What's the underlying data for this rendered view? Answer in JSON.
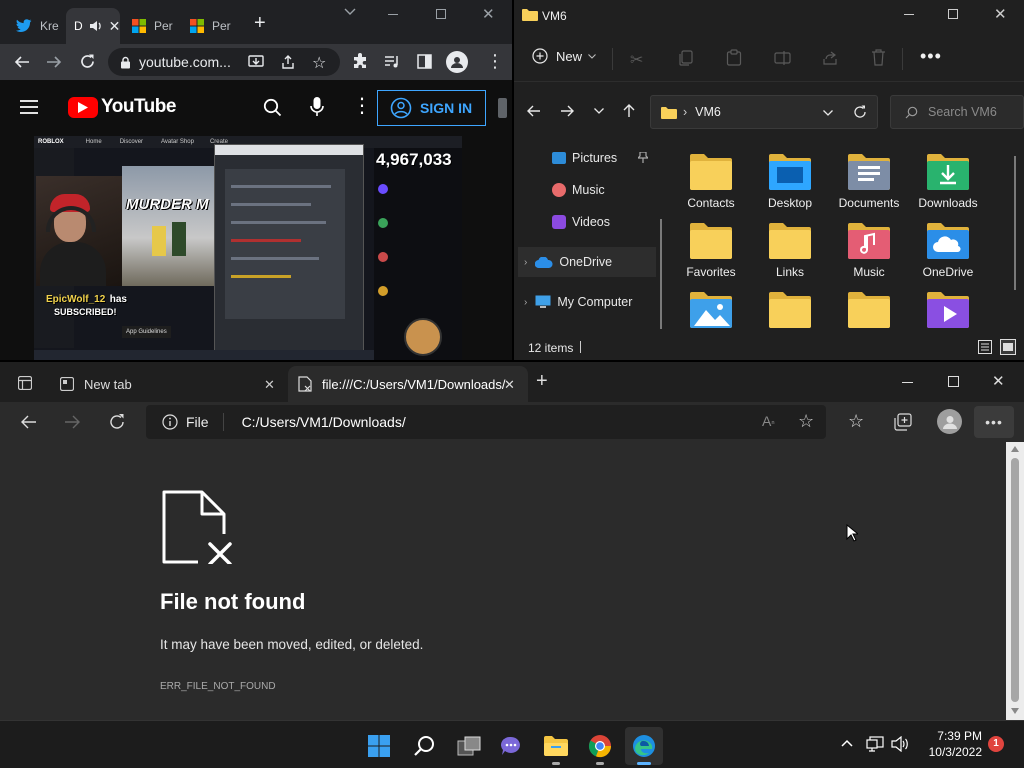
{
  "chrome": {
    "tabs": [
      {
        "label": "Kre"
      },
      {
        "label": "D"
      },
      {
        "label": "Per"
      },
      {
        "label": "Per"
      }
    ],
    "url": "youtube.com...",
    "youtube": {
      "brand": "YouTube",
      "sign_in": "SIGN IN",
      "video": {
        "viewer_count": "4,967,033",
        "game_title": "MURDER M",
        "sub_user": "EpicWolf_12",
        "sub_text_has": "has",
        "sub_text_subscribed": "SUBSCRIBED!",
        "roblox_brand": "ROBLOX",
        "menu": [
          "Home",
          "Discover",
          "Avatar Shop",
          "Create"
        ],
        "app_guidelines": "App Guidelines"
      }
    }
  },
  "explorer": {
    "title": "VM6",
    "new_label": "New",
    "path": "VM6",
    "search_placeholder": "Search VM6",
    "nav": [
      {
        "label": "Pictures",
        "icon": "pictures-icon",
        "pinned": true
      },
      {
        "label": "Music",
        "icon": "music-icon"
      },
      {
        "label": "Videos",
        "icon": "videos-icon"
      },
      {
        "label": "OneDrive",
        "icon": "onedrive-icon"
      },
      {
        "label": "My Computer",
        "icon": "computer-icon"
      }
    ],
    "items": [
      {
        "label": "Contacts",
        "type": "folder"
      },
      {
        "label": "Desktop",
        "type": "desktop"
      },
      {
        "label": "Documents",
        "type": "documents"
      },
      {
        "label": "Downloads",
        "type": "downloads"
      },
      {
        "label": "Favorites",
        "type": "folder"
      },
      {
        "label": "Links",
        "type": "folder"
      },
      {
        "label": "Music",
        "type": "music"
      },
      {
        "label": "OneDrive",
        "type": "onedrive"
      },
      {
        "label": "",
        "type": "pictures"
      },
      {
        "label": "",
        "type": "folder"
      },
      {
        "label": "",
        "type": "folder"
      },
      {
        "label": "",
        "type": "videos"
      }
    ],
    "status": "12 items"
  },
  "edge": {
    "tabs": [
      {
        "label": "New tab"
      },
      {
        "label": "file:///C:/Users/VM1/Downloads/"
      }
    ],
    "scheme_label": "File",
    "address": "C:/Users/VM1/Downloads/",
    "error": {
      "title": "File not found",
      "message": "It may have been moved, edited, or deleted.",
      "code": "ERR_FILE_NOT_FOUND"
    }
  },
  "taskbar": {
    "time": "7:39 PM",
    "date": "10/3/2022",
    "notification_count": "1"
  },
  "colors": {
    "youtube_red": "#ff0000",
    "signin_blue": "#3ea6ff",
    "folder_yellow": "#f8d05a",
    "win_blue": "#1e90ff",
    "edge_bg": "#2b2b2b"
  }
}
